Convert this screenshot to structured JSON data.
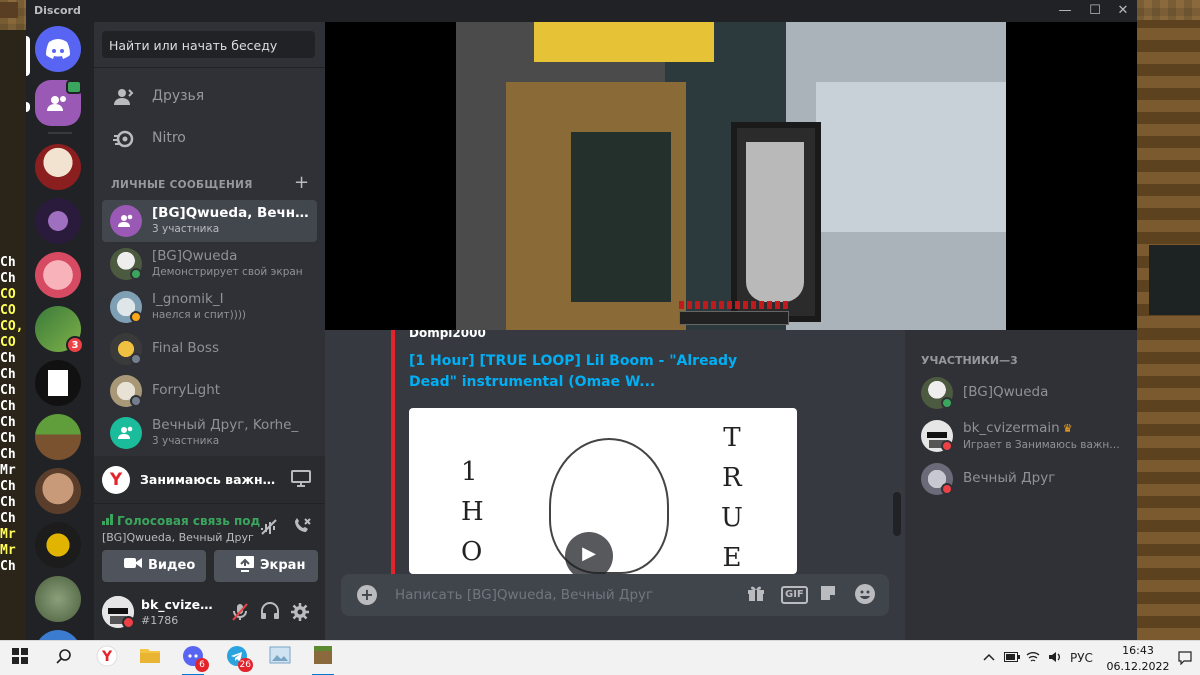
{
  "window": {
    "title": "Discord",
    "controls": [
      "—",
      "☐",
      "✕"
    ]
  },
  "left_strip_lines": [
    "Ch",
    "Ch",
    "CO",
    "CO",
    "CO,",
    "CO",
    "Ch",
    "Ch",
    "Ch",
    "Ch",
    "Ch",
    "Ch",
    "Ch",
    "Mr",
    "Ch",
    "Ch",
    "Ch",
    "Mr",
    "Mr",
    "Ch"
  ],
  "rail": {
    "badges": {
      "server4": "3"
    }
  },
  "sidebar": {
    "search_placeholder": "Найти или начать беседу",
    "nav": [
      {
        "label": "Друзья",
        "icon": "friends-icon"
      },
      {
        "label": "Nitro",
        "icon": "nitro-icon"
      }
    ],
    "dm_header": "ЛИЧНЫЕ СООБЩЕНИЯ",
    "dm_add": "+",
    "dms": [
      {
        "name": "[BG]Qwueda, Вечный...",
        "sub": "3 участника",
        "active": true
      },
      {
        "name": "[BG]Qwueda",
        "sub": "Демонстрирует свой экран",
        "status": "online"
      },
      {
        "name": "I_gnomik_I",
        "sub": "наелся и спит))))",
        "status": "idle"
      },
      {
        "name": "Final Boss",
        "sub": "",
        "status": "offline"
      },
      {
        "name": "ForryLight",
        "sub": "",
        "status": "offline"
      },
      {
        "name": "Вечный Друг, Korhe_",
        "sub": "3 участника"
      }
    ],
    "activity": {
      "logo": "Y",
      "text": "Занимаюсь важным..."
    },
    "voice": {
      "status": "Голосовая связь под",
      "channel": "[BG]Qwueda, Вечный Друг",
      "video_label": "Видео",
      "screen_label": "Экран"
    },
    "user": {
      "name": "bk_cvizer...",
      "tag": "#1786"
    }
  },
  "embed": {
    "author": "Dompl2000",
    "title": "[1 Hour] [TRUE LOOP] Lil Boom - \"Already Dead\" instrumental (Omae W...",
    "thumb_left": "1\nH\nO",
    "thumb_right": "T\nR\nU\nE\nL"
  },
  "composer": {
    "placeholder": "Написать [BG]Qwueda, Вечный Друг",
    "gif_label": "GIF"
  },
  "members": {
    "header": "УЧАСТНИКИ—3",
    "list": [
      {
        "name": "[BG]Qwueda",
        "sub": "",
        "status": "online"
      },
      {
        "name": "bk_cvizermain",
        "sub": "Играет в Занимаюсь важны...",
        "status": "dnd",
        "crown": true
      },
      {
        "name": "Вечный Друг",
        "sub": "",
        "status": "dnd"
      }
    ]
  },
  "taskbar": {
    "lang": "РУС",
    "time": "16:43",
    "date": "06.12.2022",
    "discord_badge": "6",
    "telegram_badge": "26"
  },
  "colors": {
    "accent": "#5865f2",
    "online": "#3ba55d",
    "idle": "#faa81a",
    "dnd": "#ed4245",
    "offline": "#747f8d",
    "link": "#00aff4"
  }
}
